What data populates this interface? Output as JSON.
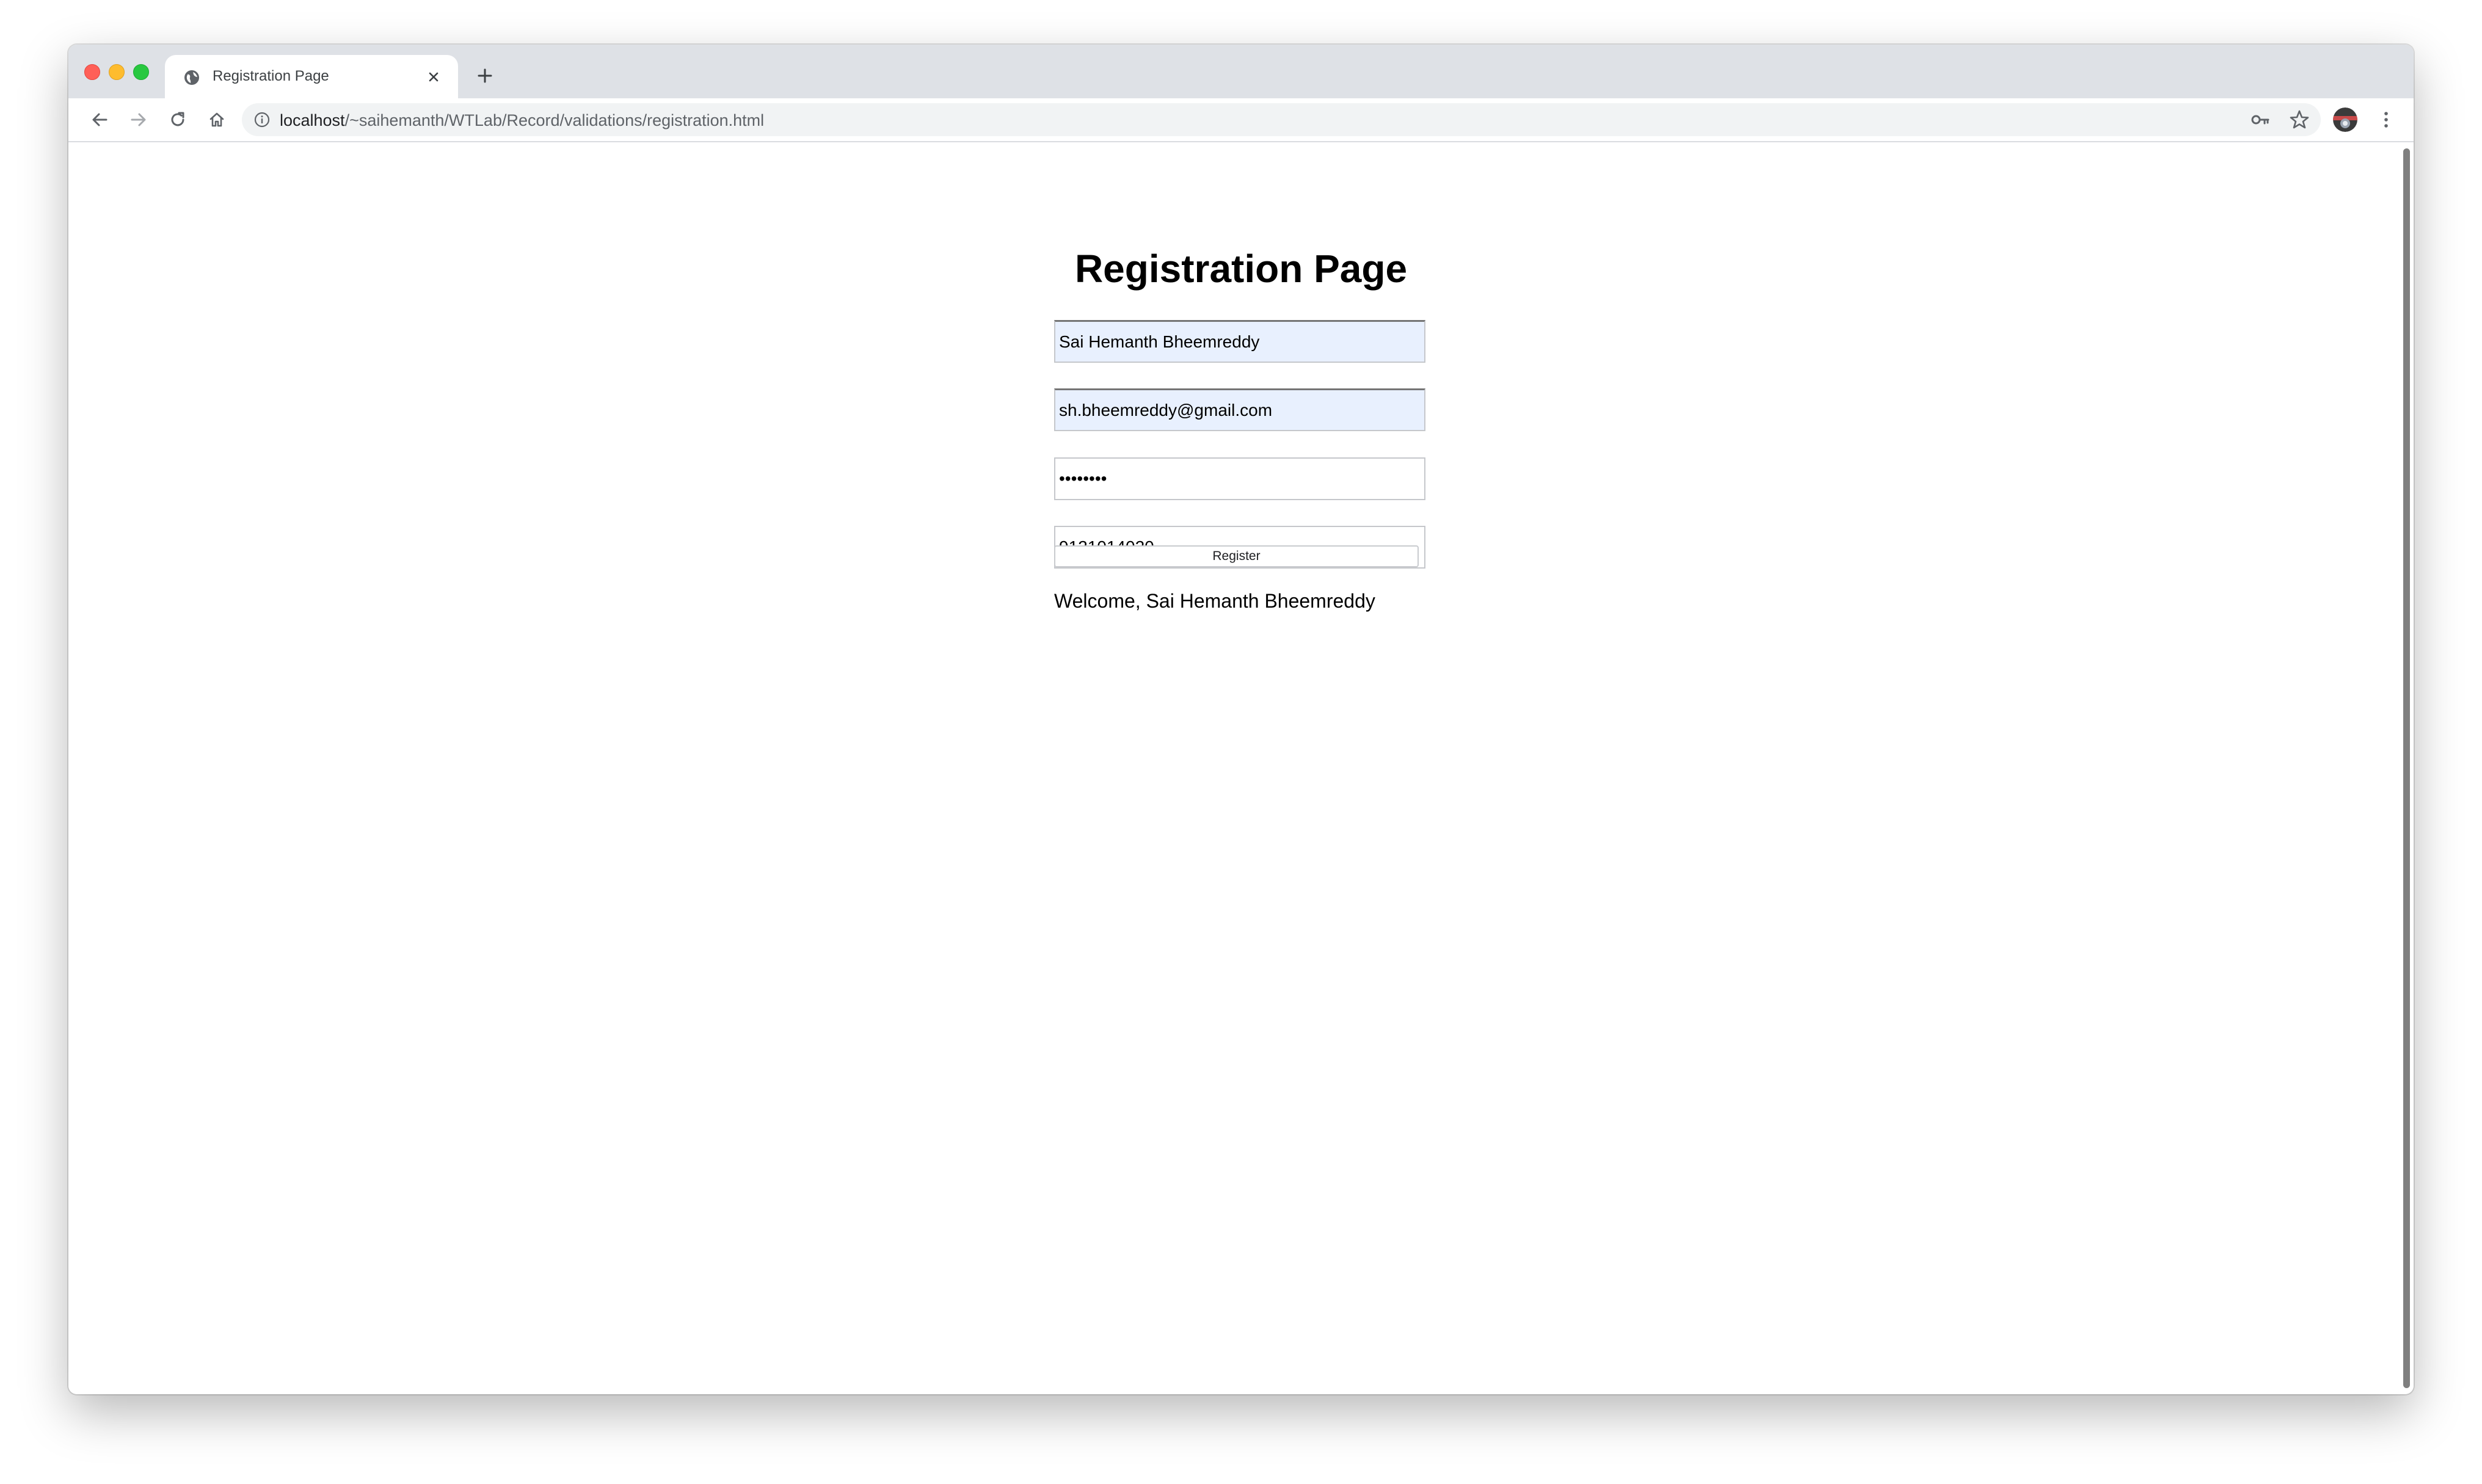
{
  "browser": {
    "tab": {
      "title": "Registration Page",
      "favicon": "globe-icon"
    },
    "address": {
      "host": "localhost",
      "path": "/~saihemanth/WTLab/Record/validations/registration.html"
    },
    "icons": {
      "back": "arrow-left-icon",
      "forward": "arrow-right-icon",
      "reload": "reload-icon",
      "home": "home-icon",
      "key": "key-icon",
      "star": "star-icon",
      "menu": "kebab-menu-icon"
    }
  },
  "page": {
    "title": "Registration Page",
    "form": {
      "name_value": "Sai Hemanth Bheemreddy",
      "email_value": "sh.bheemreddy@gmail.com",
      "password_value": "password",
      "phone_value": "9121014020",
      "register_label": "Register"
    },
    "welcome_message": "Welcome, Sai Hemanth Bheemreddy"
  },
  "colors": {
    "tabstrip": "#dee1e6",
    "autofill_background": "#e8f0fe",
    "traffic_close": "#ff5f57",
    "traffic_minimize": "#febc2e",
    "traffic_maximize": "#28c840"
  }
}
